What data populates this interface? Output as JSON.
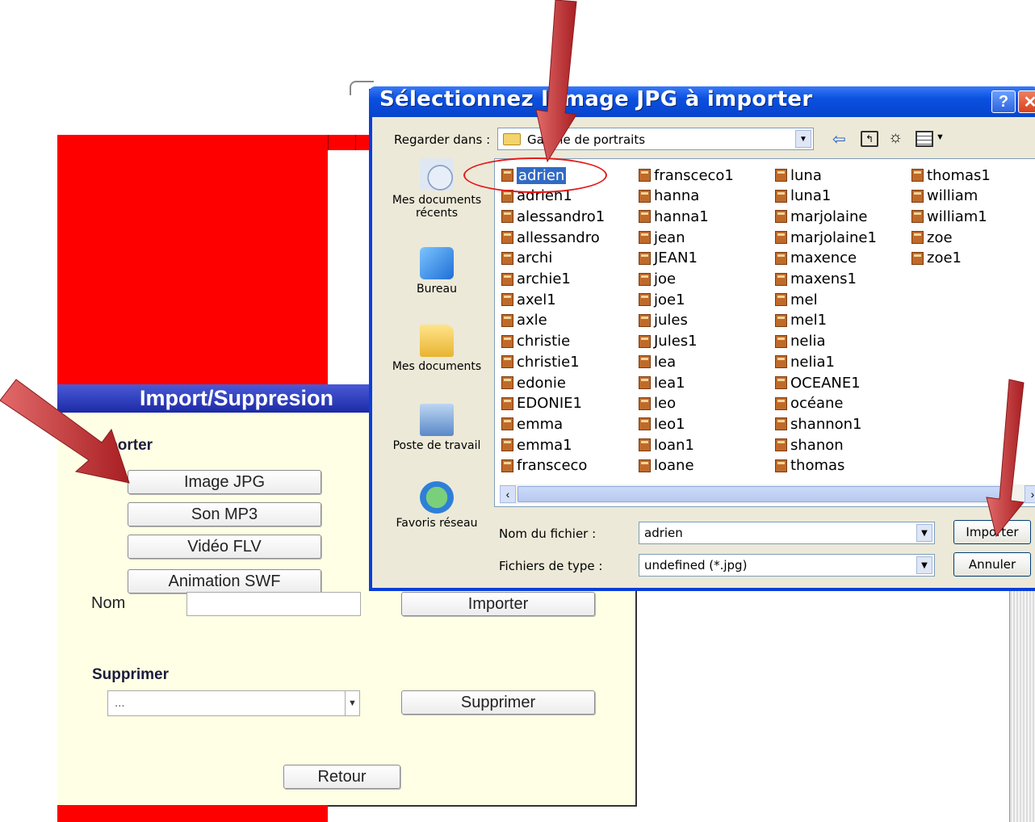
{
  "app": {
    "panel_title": "Import/Suppresion",
    "import_section": "Importer",
    "import_buttons": [
      "Image JPG",
      "Son MP3",
      "Vidéo FLV",
      "Animation SWF"
    ],
    "name_label": "Nom",
    "name_value": "",
    "import_button": "Importer",
    "delete_section": "Supprimer",
    "delete_select_value": "...",
    "delete_button": "Supprimer",
    "back_button": "Retour"
  },
  "dialog": {
    "title": "Sélectionnez l'image JPG à importer",
    "look_in_label": "Regarder dans :",
    "look_in_value": "Galerie de portraits",
    "places": [
      {
        "label": "Mes documents récents",
        "icon": "recent-documents-icon"
      },
      {
        "label": "Bureau",
        "icon": "desktop-icon"
      },
      {
        "label": "Mes documents",
        "icon": "my-documents-icon"
      },
      {
        "label": "Poste de travail",
        "icon": "my-computer-icon"
      },
      {
        "label": "Favoris réseau",
        "icon": "network-places-icon"
      }
    ],
    "files": [
      [
        "adrien",
        "adrien1",
        "alessandro1",
        "allessandro",
        "archi",
        "archie1",
        "axel1",
        "axle",
        "christie",
        "christie1",
        "edonie",
        "EDONIE1",
        "emma",
        "emma1",
        "fransceco"
      ],
      [
        "fransceco1",
        "hanna",
        "hanna1",
        "jean",
        "JEAN1",
        "joe",
        "joe1",
        "jules",
        "Jules1",
        "lea",
        "lea1",
        "leo",
        "leo1",
        "loan1",
        "loane"
      ],
      [
        "luna",
        "luna1",
        "marjolaine",
        "marjolaine1",
        "maxence",
        "maxens1",
        "mel",
        "mel1",
        "nelia",
        "nelia1",
        "OCEANE1",
        "océane",
        "shannon1",
        "shanon",
        "thomas"
      ],
      [
        "thomas1",
        "william",
        "william1",
        "zoe",
        "zoe1"
      ]
    ],
    "selected_file": "adrien",
    "filename_label": "Nom du fichier :",
    "filename_value": "adrien",
    "filetype_label": "Fichiers de type :",
    "filetype_value": "undefined (*.jpg)",
    "open_button": "Importer",
    "cancel_button": "Annuler"
  },
  "colors": {
    "titlebar": "#0a50e0",
    "selection": "#316ac5",
    "panel_background": "#ffffe5",
    "header_background": "#1c2aa6",
    "red_area": "#ff0000",
    "annotation": "#c0393b"
  }
}
